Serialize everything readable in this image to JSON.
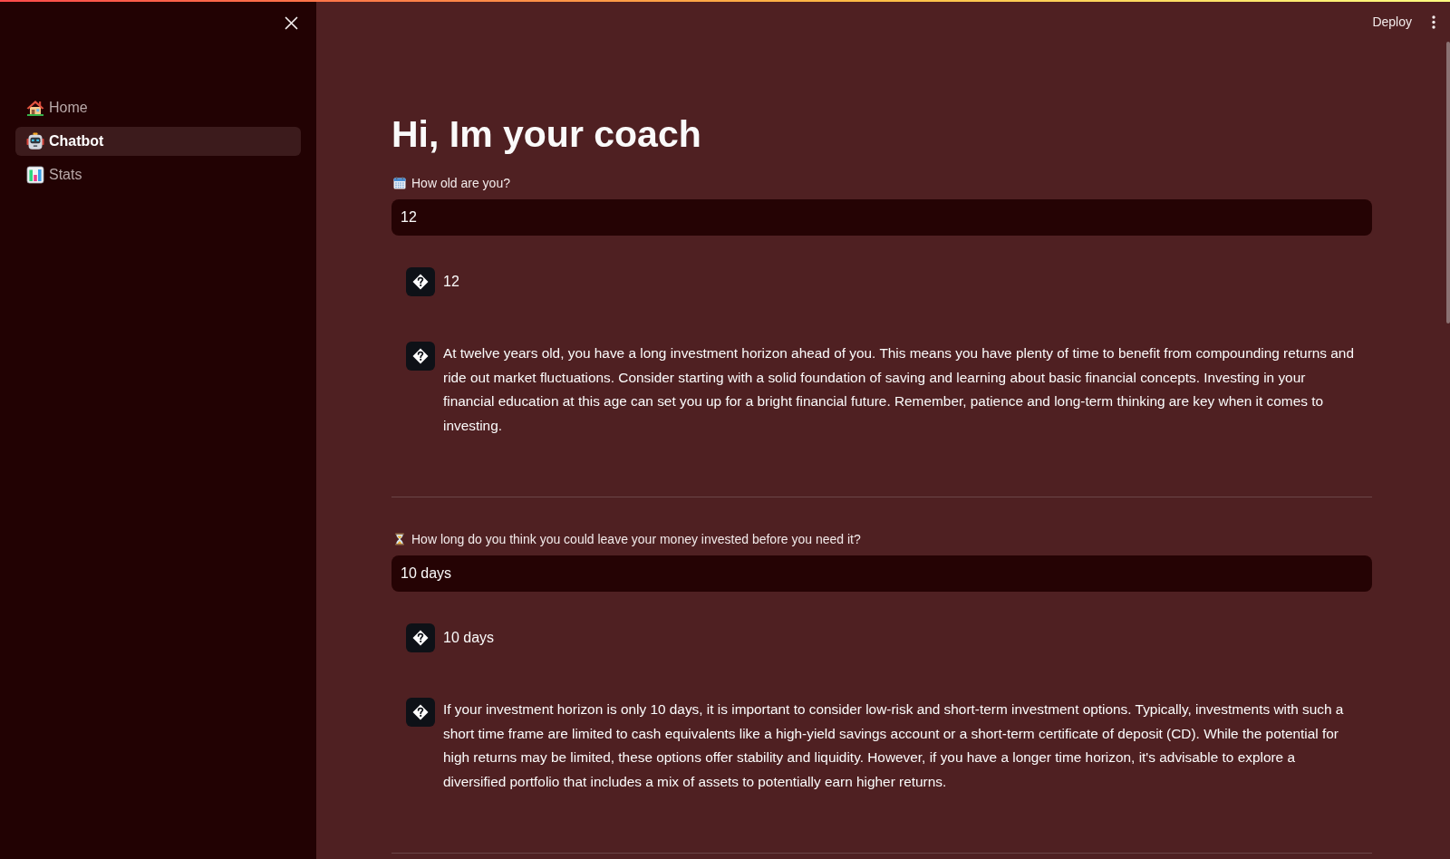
{
  "header": {
    "deploy_label": "Deploy"
  },
  "sidebar": {
    "items": [
      {
        "label": "Home",
        "selected": false
      },
      {
        "label": "Chatbot",
        "selected": true
      },
      {
        "label": "Stats",
        "selected": false
      }
    ]
  },
  "main": {
    "title": "Hi, Im your coach",
    "questions": [
      {
        "label": "How old are you?",
        "value": "12",
        "messages": [
          {
            "text": "12"
          },
          {
            "text": "At twelve years old, you have a long investment horizon ahead of you. This means you have plenty of time to benefit from compounding returns and ride out market fluctuations. Consider starting with a solid foundation of saving and learning about basic financial concepts. Investing in your financial education at this age can set you up for a bright financial future. Remember, patience and long-term thinking are key when it comes to investing."
          }
        ]
      },
      {
        "label": "How long do you think you could leave your money invested before you need it?",
        "value": "10 days",
        "messages": [
          {
            "text": "10 days"
          },
          {
            "text": "If your investment horizon is only 10 days, it is important to consider low-risk and short-term investment options. Typically, investments with such a short time frame are limited to cash equivalents like a high-yield savings account or a short-term certificate of deposit (CD). While the potential for high returns may be limited, these options offer stability and liquidity. However, if you have a longer time horizon, it's advisable to explore a diversified portfolio that includes a mix of assets to potentially earn higher returns."
          }
        ]
      }
    ]
  }
}
